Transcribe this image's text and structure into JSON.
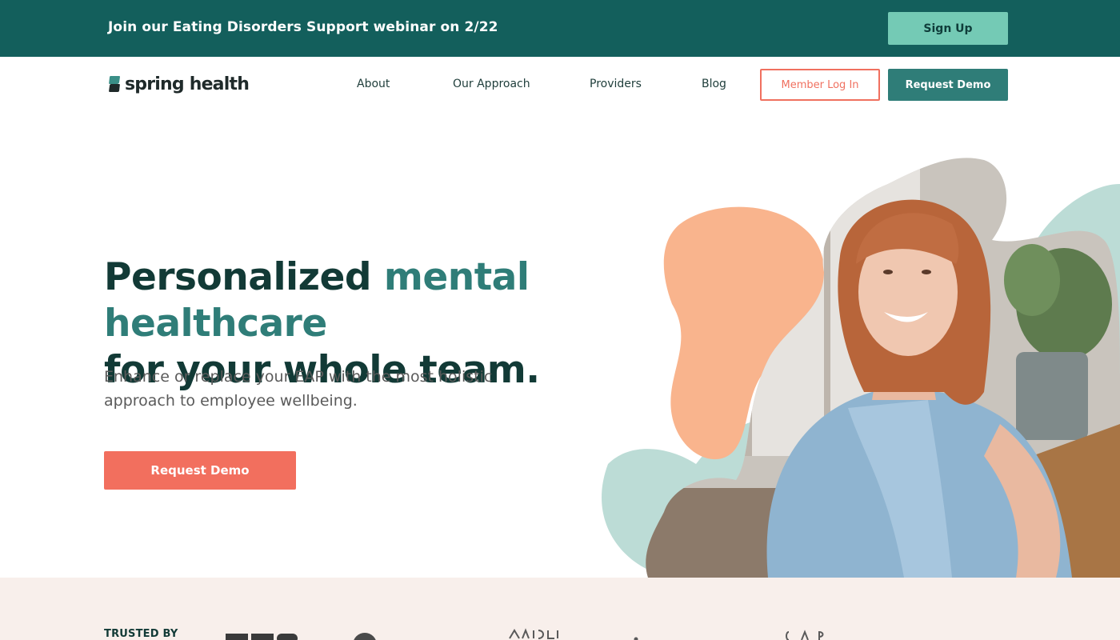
{
  "banner": {
    "text": "Join our Eating Disorders Support webinar on 2/22",
    "signup_label": "Sign Up"
  },
  "brand": {
    "name": "spring health",
    "accent": "#2f7d78",
    "coral": "#f26f5e",
    "banner_bg": "#135f5c"
  },
  "nav": {
    "items": [
      {
        "label": "About"
      },
      {
        "label": "Our Approach"
      },
      {
        "label": "Providers"
      },
      {
        "label": "Blog"
      }
    ],
    "login_label": "Member Log In",
    "demo_label": "Request Demo"
  },
  "hero": {
    "headline_part1": "Personalized ",
    "headline_accent": "mental healthcare",
    "headline_part2": "for your whole team.",
    "subhead": "Enhance or replace your EAP with the most holistic approach to employee wellbeing.",
    "cta_label": "Request Demo"
  },
  "trusted": {
    "label": "TRUSTED BY"
  }
}
